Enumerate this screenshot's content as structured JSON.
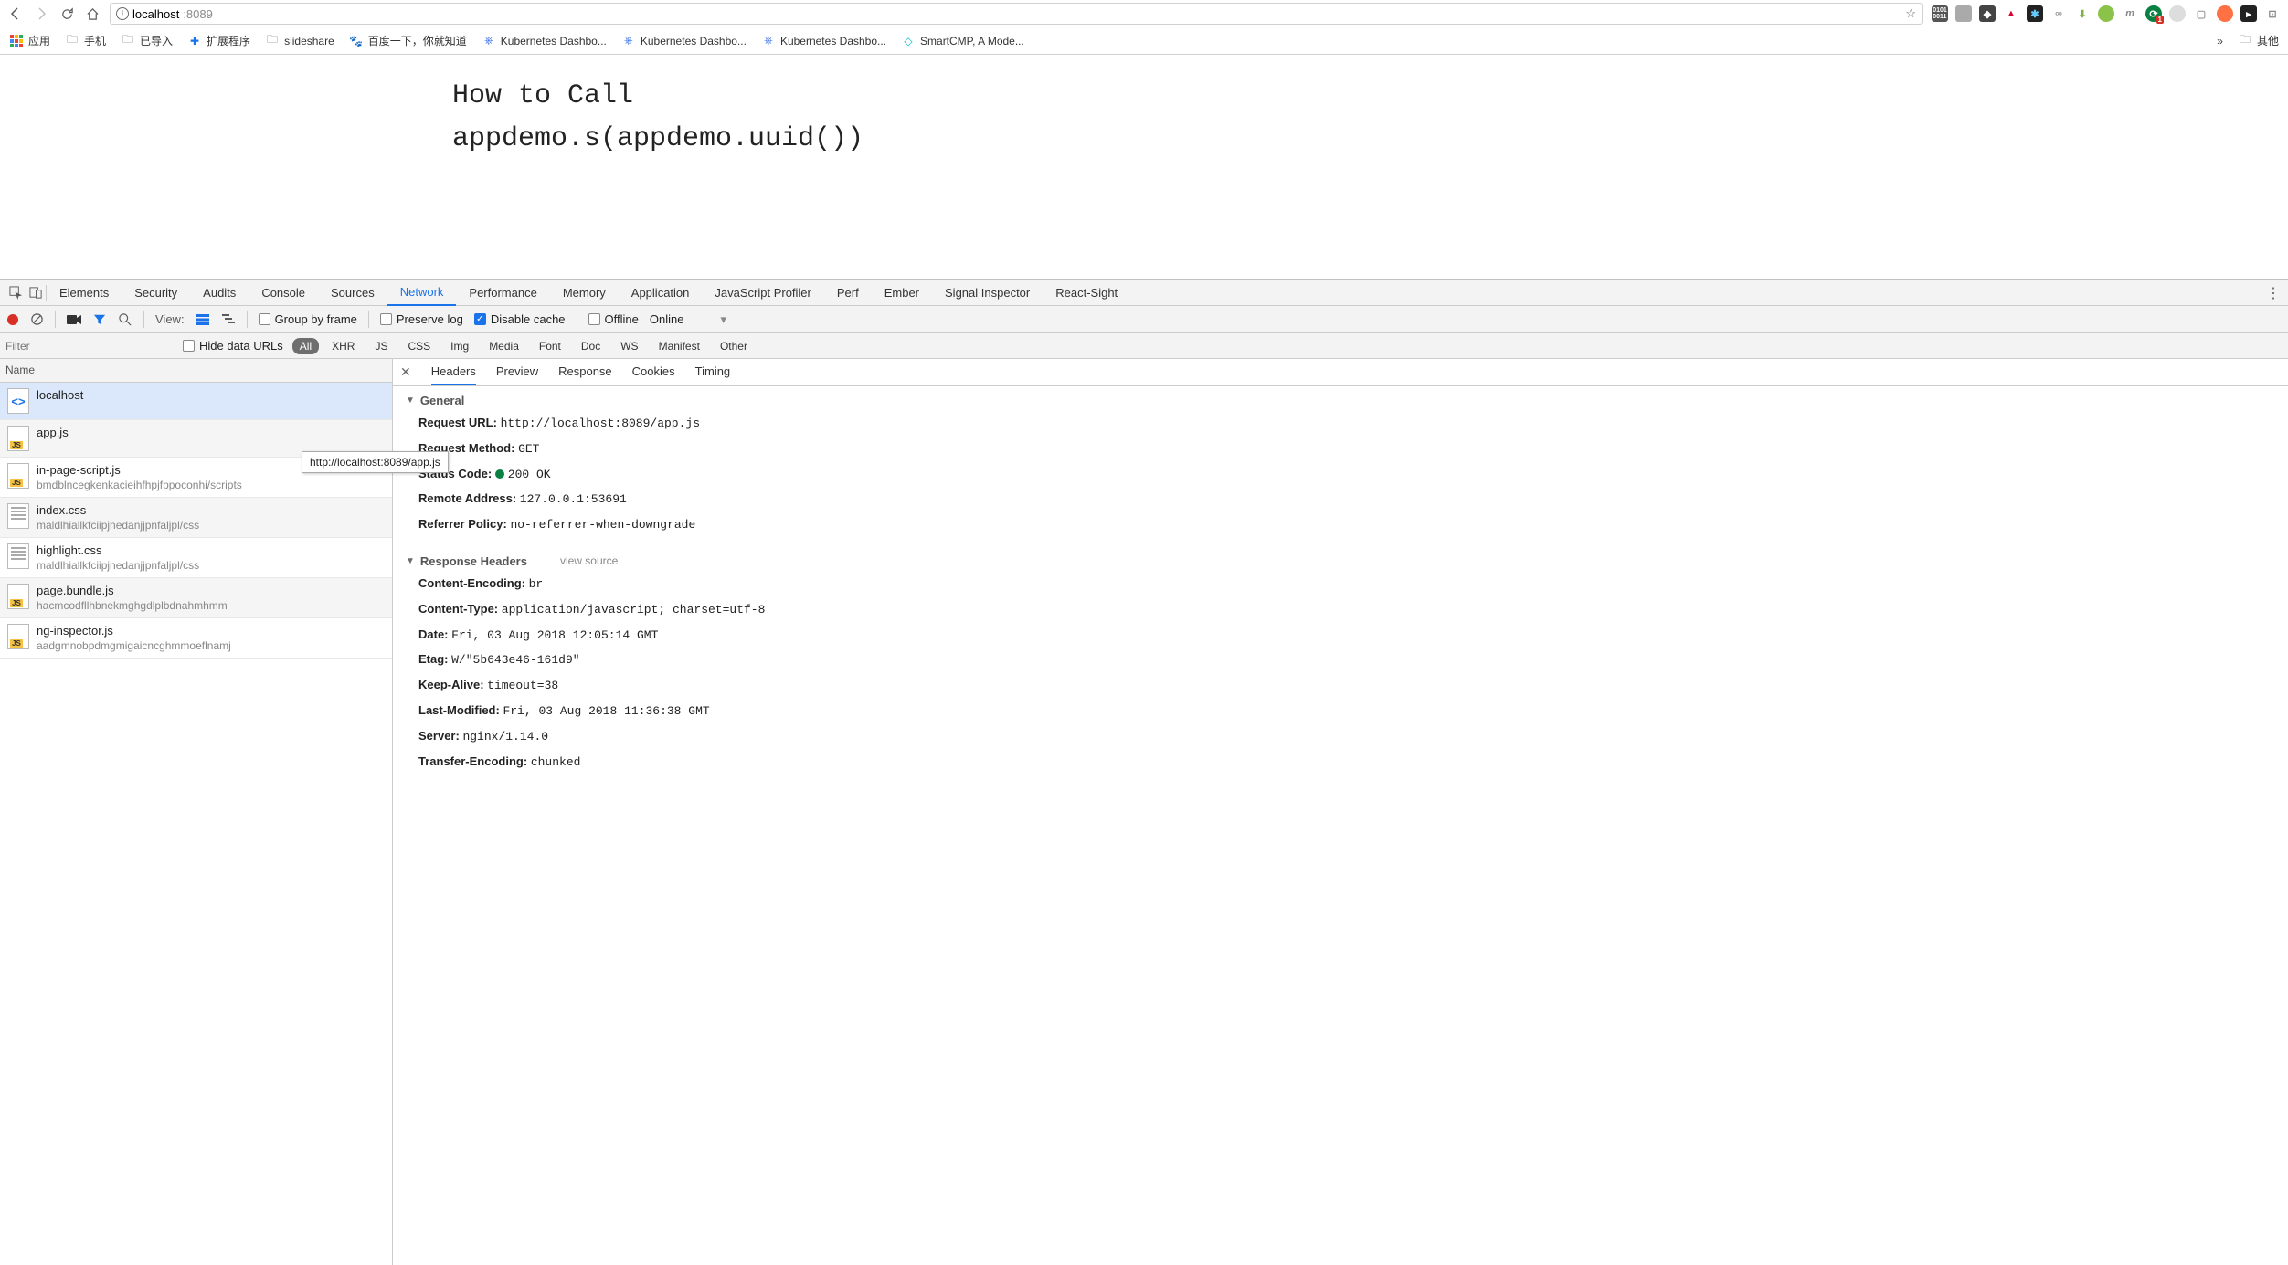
{
  "url": {
    "host": "localhost",
    "port": ":8089"
  },
  "bookmarks": [
    {
      "icon": "apps",
      "label": "应用"
    },
    {
      "icon": "folder",
      "label": "手机"
    },
    {
      "icon": "folder",
      "label": "已导入"
    },
    {
      "icon": "puzzle",
      "label": "扩展程序"
    },
    {
      "icon": "folder",
      "label": "slideshare"
    },
    {
      "icon": "baidu",
      "label": "百度一下，你就知道"
    },
    {
      "icon": "k8s",
      "label": "Kubernetes Dashbo..."
    },
    {
      "icon": "k8s",
      "label": "Kubernetes Dashbo..."
    },
    {
      "icon": "k8s",
      "label": "Kubernetes Dashbo..."
    },
    {
      "icon": "smart",
      "label": "SmartCMP, A Mode..."
    }
  ],
  "bm_overflow": "»",
  "bm_other": "其他",
  "page_text": "How to Call\nappdemo.s(appdemo.uuid())",
  "devtools_tabs": [
    "Elements",
    "Security",
    "Audits",
    "Console",
    "Sources",
    "Network",
    "Performance",
    "Memory",
    "Application",
    "JavaScript Profiler",
    "Perf",
    "Ember",
    "Signal Inspector",
    "React-Sight"
  ],
  "devtools_active": "Network",
  "net_toolbar": {
    "view_label": "View:",
    "group_by_frame": "Group by frame",
    "preserve_log": "Preserve log",
    "disable_cache": "Disable cache",
    "offline": "Offline",
    "online": "Online"
  },
  "filter": {
    "placeholder": "Filter",
    "hide_data_urls": "Hide data URLs",
    "types": [
      "All",
      "XHR",
      "JS",
      "CSS",
      "Img",
      "Media",
      "Font",
      "Doc",
      "WS",
      "Manifest",
      "Other"
    ],
    "active": "All"
  },
  "req_header": "Name",
  "requests": [
    {
      "name": "localhost",
      "sub": "",
      "type": "html",
      "selected": true
    },
    {
      "name": "app.js",
      "sub": "",
      "type": "js",
      "hover": true
    },
    {
      "name": "in-page-script.js",
      "sub": "bmdblncegkenkacieihfhpjfppoconhi/scripts",
      "type": "js"
    },
    {
      "name": "index.css",
      "sub": "maldlhiallkfciipjnedanjjpnfaljpl/css",
      "type": "css"
    },
    {
      "name": "highlight.css",
      "sub": "maldlhiallkfciipjnedanjjpnfaljpl/css",
      "type": "css"
    },
    {
      "name": "page.bundle.js",
      "sub": "hacmcodfllhbnekmghgdlplbdnahmhmm",
      "type": "js"
    },
    {
      "name": "ng-inspector.js",
      "sub": "aadgmnobpdmgmigaicncghmmoeflnamj",
      "type": "js"
    }
  ],
  "tooltip": "http://localhost:8089/app.js",
  "detail_tabs": [
    "Headers",
    "Preview",
    "Response",
    "Cookies",
    "Timing"
  ],
  "detail_active": "Headers",
  "general_label": "General",
  "general": [
    {
      "k": "Request URL:",
      "v": "http://localhost:8089/app.js"
    },
    {
      "k": "Request Method:",
      "v": "GET"
    },
    {
      "k": "Status Code:",
      "v": "200 OK",
      "status": true
    },
    {
      "k": "Remote Address:",
      "v": "127.0.0.1:53691"
    },
    {
      "k": "Referrer Policy:",
      "v": "no-referrer-when-downgrade"
    }
  ],
  "response_headers_label": "Response Headers",
  "view_source_label": "view source",
  "response_headers": [
    {
      "k": "Content-Encoding:",
      "v": "br"
    },
    {
      "k": "Content-Type:",
      "v": "application/javascript; charset=utf-8"
    },
    {
      "k": "Date:",
      "v": "Fri, 03 Aug 2018 12:05:14 GMT"
    },
    {
      "k": "Etag:",
      "v": "W/\"5b643e46-161d9\""
    },
    {
      "k": "Keep-Alive:",
      "v": "timeout=38"
    },
    {
      "k": "Last-Modified:",
      "v": "Fri, 03 Aug 2018 11:36:38 GMT"
    },
    {
      "k": "Server:",
      "v": "nginx/1.14.0"
    },
    {
      "k": "Transfer-Encoding:",
      "v": "chunked"
    }
  ]
}
